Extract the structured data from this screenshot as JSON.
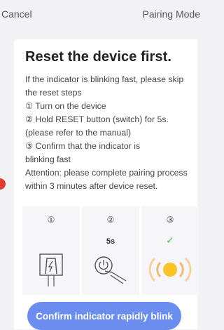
{
  "header": {
    "cancel_label": "Cancel",
    "mode_label": "Pairing Mode"
  },
  "card": {
    "title": "Reset the device first.",
    "instructions": [
      "If the indicator is blinking fast, please skip",
      "the reset steps",
      "① Turn on the device",
      "② Hold RESET button (switch) for 5s.",
      "(please refer to the manual)",
      "③ Confirm that the indicator is",
      "blinking fast",
      "Attention: please complete pairing process",
      "within 3 minutes after device reset."
    ],
    "steps": [
      {
        "number": "①",
        "icon": "plug-power-icon"
      },
      {
        "number": "②",
        "sublabel": "5s",
        "icon": "press-power-button-icon"
      },
      {
        "number": "③",
        "check": "✓",
        "icon": "blinking-indicator-icon"
      }
    ],
    "confirm_button": "Confirm indicator rapidly blink"
  },
  "colors": {
    "accent_button": "#6b8df0",
    "check_green": "#38c94e",
    "indicator_yellow": "#f7c325",
    "indicator_ring": "#f5d2a3",
    "side_dot": "#e53a2e"
  }
}
